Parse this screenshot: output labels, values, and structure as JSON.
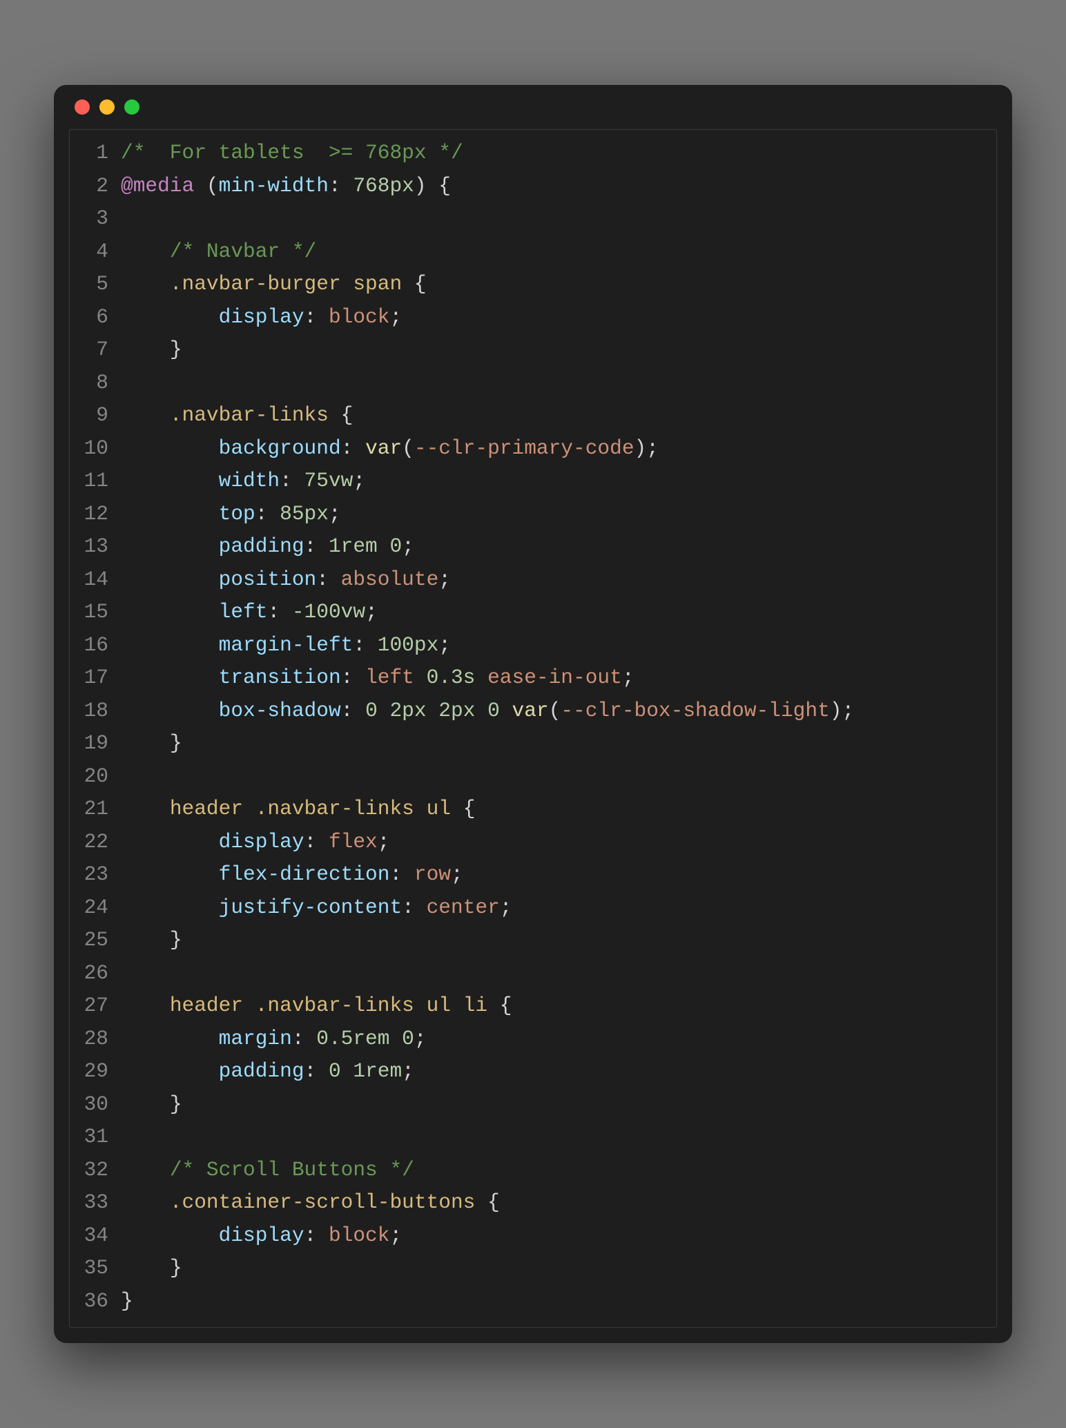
{
  "window": {
    "traffic_lights": [
      "close",
      "minimize",
      "zoom"
    ]
  },
  "code": {
    "language": "css",
    "lines": [
      [
        {
          "c": "c-comment",
          "t": "/*  For tablets  >= 768px */"
        }
      ],
      [
        {
          "c": "c-atrule",
          "t": "@media"
        },
        {
          "c": "c-text",
          "t": " "
        },
        {
          "c": "c-punc",
          "t": "("
        },
        {
          "c": "c-prop",
          "t": "min-width"
        },
        {
          "c": "c-punc",
          "t": ": "
        },
        {
          "c": "c-number",
          "t": "768px"
        },
        {
          "c": "c-punc",
          "t": ")"
        },
        {
          "c": "c-text",
          "t": " "
        },
        {
          "c": "c-punc",
          "t": "{"
        }
      ],
      [],
      [
        {
          "c": "c-text",
          "t": "    "
        },
        {
          "c": "c-comment",
          "t": "/* Navbar */"
        }
      ],
      [
        {
          "c": "c-text",
          "t": "    "
        },
        {
          "c": "c-selector",
          "t": ".navbar-burger span"
        },
        {
          "c": "c-text",
          "t": " "
        },
        {
          "c": "c-punc",
          "t": "{"
        }
      ],
      [
        {
          "c": "c-text",
          "t": "        "
        },
        {
          "c": "c-prop",
          "t": "display"
        },
        {
          "c": "c-punc",
          "t": ": "
        },
        {
          "c": "c-value",
          "t": "block"
        },
        {
          "c": "c-punc",
          "t": ";"
        }
      ],
      [
        {
          "c": "c-text",
          "t": "    "
        },
        {
          "c": "c-punc",
          "t": "}"
        }
      ],
      [],
      [
        {
          "c": "c-text",
          "t": "    "
        },
        {
          "c": "c-selector",
          "t": ".navbar-links"
        },
        {
          "c": "c-text",
          "t": " "
        },
        {
          "c": "c-punc",
          "t": "{"
        }
      ],
      [
        {
          "c": "c-text",
          "t": "        "
        },
        {
          "c": "c-prop",
          "t": "background"
        },
        {
          "c": "c-punc",
          "t": ": "
        },
        {
          "c": "c-func",
          "t": "var"
        },
        {
          "c": "c-punc",
          "t": "("
        },
        {
          "c": "c-value",
          "t": "--clr-primary-code"
        },
        {
          "c": "c-punc",
          "t": ")"
        },
        {
          "c": "c-punc",
          "t": ";"
        }
      ],
      [
        {
          "c": "c-text",
          "t": "        "
        },
        {
          "c": "c-prop",
          "t": "width"
        },
        {
          "c": "c-punc",
          "t": ": "
        },
        {
          "c": "c-number",
          "t": "75vw"
        },
        {
          "c": "c-punc",
          "t": ";"
        }
      ],
      [
        {
          "c": "c-text",
          "t": "        "
        },
        {
          "c": "c-prop",
          "t": "top"
        },
        {
          "c": "c-punc",
          "t": ": "
        },
        {
          "c": "c-number",
          "t": "85px"
        },
        {
          "c": "c-punc",
          "t": ";"
        }
      ],
      [
        {
          "c": "c-text",
          "t": "        "
        },
        {
          "c": "c-prop",
          "t": "padding"
        },
        {
          "c": "c-punc",
          "t": ": "
        },
        {
          "c": "c-number",
          "t": "1rem"
        },
        {
          "c": "c-text",
          "t": " "
        },
        {
          "c": "c-number",
          "t": "0"
        },
        {
          "c": "c-punc",
          "t": ";"
        }
      ],
      [
        {
          "c": "c-text",
          "t": "        "
        },
        {
          "c": "c-prop",
          "t": "position"
        },
        {
          "c": "c-punc",
          "t": ": "
        },
        {
          "c": "c-value",
          "t": "absolute"
        },
        {
          "c": "c-punc",
          "t": ";"
        }
      ],
      [
        {
          "c": "c-text",
          "t": "        "
        },
        {
          "c": "c-prop",
          "t": "left"
        },
        {
          "c": "c-punc",
          "t": ": "
        },
        {
          "c": "c-number",
          "t": "-100vw"
        },
        {
          "c": "c-punc",
          "t": ";"
        }
      ],
      [
        {
          "c": "c-text",
          "t": "        "
        },
        {
          "c": "c-prop",
          "t": "margin-left"
        },
        {
          "c": "c-punc",
          "t": ": "
        },
        {
          "c": "c-number",
          "t": "100px"
        },
        {
          "c": "c-punc",
          "t": ";"
        }
      ],
      [
        {
          "c": "c-text",
          "t": "        "
        },
        {
          "c": "c-prop",
          "t": "transition"
        },
        {
          "c": "c-punc",
          "t": ": "
        },
        {
          "c": "c-value",
          "t": "left "
        },
        {
          "c": "c-number",
          "t": "0.3s"
        },
        {
          "c": "c-value",
          "t": " ease-in-out"
        },
        {
          "c": "c-punc",
          "t": ";"
        }
      ],
      [
        {
          "c": "c-text",
          "t": "        "
        },
        {
          "c": "c-prop",
          "t": "box-shadow"
        },
        {
          "c": "c-punc",
          "t": ": "
        },
        {
          "c": "c-number",
          "t": "0"
        },
        {
          "c": "c-text",
          "t": " "
        },
        {
          "c": "c-number",
          "t": "2px"
        },
        {
          "c": "c-text",
          "t": " "
        },
        {
          "c": "c-number",
          "t": "2px"
        },
        {
          "c": "c-text",
          "t": " "
        },
        {
          "c": "c-number",
          "t": "0"
        },
        {
          "c": "c-text",
          "t": " "
        },
        {
          "c": "c-func",
          "t": "var"
        },
        {
          "c": "c-punc",
          "t": "("
        },
        {
          "c": "c-value",
          "t": "--clr-box-shadow-light"
        },
        {
          "c": "c-punc",
          "t": ")"
        },
        {
          "c": "c-punc",
          "t": ";"
        }
      ],
      [
        {
          "c": "c-text",
          "t": "    "
        },
        {
          "c": "c-punc",
          "t": "}"
        }
      ],
      [],
      [
        {
          "c": "c-text",
          "t": "    "
        },
        {
          "c": "c-selector",
          "t": "header .navbar-links ul"
        },
        {
          "c": "c-text",
          "t": " "
        },
        {
          "c": "c-punc",
          "t": "{"
        }
      ],
      [
        {
          "c": "c-text",
          "t": "        "
        },
        {
          "c": "c-prop",
          "t": "display"
        },
        {
          "c": "c-punc",
          "t": ": "
        },
        {
          "c": "c-value",
          "t": "flex"
        },
        {
          "c": "c-punc",
          "t": ";"
        }
      ],
      [
        {
          "c": "c-text",
          "t": "        "
        },
        {
          "c": "c-prop",
          "t": "flex-direction"
        },
        {
          "c": "c-punc",
          "t": ": "
        },
        {
          "c": "c-value",
          "t": "row"
        },
        {
          "c": "c-punc",
          "t": ";"
        }
      ],
      [
        {
          "c": "c-text",
          "t": "        "
        },
        {
          "c": "c-prop",
          "t": "justify-content"
        },
        {
          "c": "c-punc",
          "t": ": "
        },
        {
          "c": "c-value",
          "t": "center"
        },
        {
          "c": "c-punc",
          "t": ";"
        }
      ],
      [
        {
          "c": "c-text",
          "t": "    "
        },
        {
          "c": "c-punc",
          "t": "}"
        }
      ],
      [],
      [
        {
          "c": "c-text",
          "t": "    "
        },
        {
          "c": "c-selector",
          "t": "header .navbar-links ul li"
        },
        {
          "c": "c-text",
          "t": " "
        },
        {
          "c": "c-punc",
          "t": "{"
        }
      ],
      [
        {
          "c": "c-text",
          "t": "        "
        },
        {
          "c": "c-prop",
          "t": "margin"
        },
        {
          "c": "c-punc",
          "t": ": "
        },
        {
          "c": "c-number",
          "t": "0.5rem"
        },
        {
          "c": "c-text",
          "t": " "
        },
        {
          "c": "c-number",
          "t": "0"
        },
        {
          "c": "c-punc",
          "t": ";"
        }
      ],
      [
        {
          "c": "c-text",
          "t": "        "
        },
        {
          "c": "c-prop",
          "t": "padding"
        },
        {
          "c": "c-punc",
          "t": ": "
        },
        {
          "c": "c-number",
          "t": "0"
        },
        {
          "c": "c-text",
          "t": " "
        },
        {
          "c": "c-number",
          "t": "1rem"
        },
        {
          "c": "c-punc",
          "t": ";"
        }
      ],
      [
        {
          "c": "c-text",
          "t": "    "
        },
        {
          "c": "c-punc",
          "t": "}"
        }
      ],
      [],
      [
        {
          "c": "c-text",
          "t": "    "
        },
        {
          "c": "c-comment",
          "t": "/* Scroll Buttons */"
        }
      ],
      [
        {
          "c": "c-text",
          "t": "    "
        },
        {
          "c": "c-selector",
          "t": ".container-scroll-buttons"
        },
        {
          "c": "c-text",
          "t": " "
        },
        {
          "c": "c-punc",
          "t": "{"
        }
      ],
      [
        {
          "c": "c-text",
          "t": "        "
        },
        {
          "c": "c-prop",
          "t": "display"
        },
        {
          "c": "c-punc",
          "t": ": "
        },
        {
          "c": "c-value",
          "t": "block"
        },
        {
          "c": "c-punc",
          "t": ";"
        }
      ],
      [
        {
          "c": "c-text",
          "t": "    "
        },
        {
          "c": "c-punc",
          "t": "}"
        }
      ],
      [
        {
          "c": "c-punc",
          "t": "}"
        }
      ]
    ]
  }
}
